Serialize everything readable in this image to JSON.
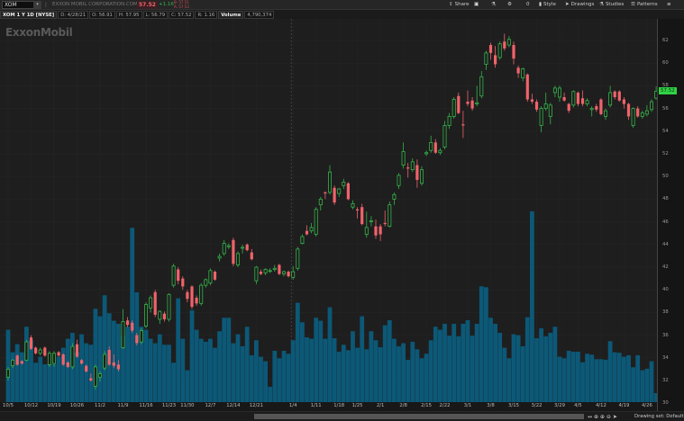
{
  "topbar": {
    "symbol": "XOM",
    "symbol_dropdown_icon": "chevron-down-icon",
    "company_name": "EXXON MOBIL CORPORATION.COM",
    "last_price": "57.52",
    "change": "+1.16",
    "bid": "B: 57.51",
    "ask": "A: 57.53",
    "toolbar": [
      {
        "icon": "share-icon",
        "glyph": "⇪",
        "label": "Share"
      },
      {
        "icon": "screenshot-icon",
        "glyph": "▣",
        "label": ""
      },
      {
        "icon": "flask-icon",
        "glyph": "⚗",
        "label": ""
      },
      {
        "icon": "gear-icon",
        "glyph": "⚙",
        "label": ""
      },
      {
        "icon": "counter-icon",
        "glyph": "",
        "label": "0"
      },
      {
        "icon": "style-icon",
        "glyph": "▮",
        "label": "Style"
      },
      {
        "icon": "cursor-icon",
        "glyph": "➤",
        "label": "Drawings"
      },
      {
        "icon": "studies-icon",
        "glyph": "⚗",
        "label": "Studies"
      },
      {
        "icon": "patterns-icon",
        "glyph": "☰",
        "label": "Patterns"
      },
      {
        "icon": "menu-icon",
        "glyph": "≡",
        "label": ""
      }
    ]
  },
  "info": {
    "title": "XOM 1 Y 1D [NYSE]",
    "date": "D: 4/28/21",
    "open": "O: 56.91",
    "high": "H: 57.95",
    "low": "L: 56.79",
    "close": "C: 57.52",
    "range": "R: 1.16",
    "volume_label": "Volume",
    "volume": "4,790,374"
  },
  "logo": "ExxonMobil",
  "footer": {
    "drawing_set": "Drawing set: Default"
  },
  "colors": {
    "up": "#35b34a",
    "down": "#f0636b",
    "volume": "#0c5877",
    "last_price_bg": "#2fd244"
  },
  "chart_data": {
    "type": "candlestick",
    "price_axis": {
      "min": 30,
      "max": 62,
      "ticks": [
        30,
        32,
        34,
        36,
        38,
        40,
        42,
        44,
        46,
        48,
        50,
        52,
        54,
        56,
        58,
        60,
        62
      ]
    },
    "last_price_label": "57.52",
    "x_ticks": [
      {
        "index": 0,
        "label": "10/5"
      },
      {
        "index": 5,
        "label": "10/12"
      },
      {
        "index": 10,
        "label": "10/19"
      },
      {
        "index": 15,
        "label": "10/26"
      },
      {
        "index": 20,
        "label": "11/2"
      },
      {
        "index": 25,
        "label": "11/9"
      },
      {
        "index": 30,
        "label": "11/16"
      },
      {
        "index": 35,
        "label": "11/23"
      },
      {
        "index": 39,
        "label": "11/30"
      },
      {
        "index": 44,
        "label": "12/7"
      },
      {
        "index": 49,
        "label": "12/14"
      },
      {
        "index": 54,
        "label": "12/21"
      },
      {
        "index": 62,
        "label": "1/4"
      },
      {
        "index": 67,
        "label": "1/11"
      },
      {
        "index": 72,
        "label": "1/18"
      },
      {
        "index": 76,
        "label": "1/25"
      },
      {
        "index": 81,
        "label": "2/1"
      },
      {
        "index": 86,
        "label": "2/8"
      },
      {
        "index": 91,
        "label": "2/15"
      },
      {
        "index": 95,
        "label": "2/22"
      },
      {
        "index": 100,
        "label": "3/1"
      },
      {
        "index": 105,
        "label": "3/8"
      },
      {
        "index": 110,
        "label": "3/15"
      },
      {
        "index": 115,
        "label": "3/22"
      },
      {
        "index": 120,
        "label": "3/29"
      },
      {
        "index": 124,
        "label": "4/5"
      },
      {
        "index": 129,
        "label": "4/12"
      },
      {
        "index": 134,
        "label": "4/19"
      },
      {
        "index": 139,
        "label": "4/26"
      }
    ],
    "year_separator_index": 62,
    "ohlc": [
      [
        32.3,
        33.2,
        32.0,
        33.0
      ],
      [
        33.3,
        33.9,
        33.1,
        33.8
      ],
      [
        34.2,
        34.3,
        33.3,
        33.4
      ],
      [
        33.7,
        33.8,
        33.4,
        33.5
      ],
      [
        33.8,
        35.6,
        33.7,
        35.4
      ],
      [
        35.8,
        36.0,
        34.7,
        34.8
      ],
      [
        34.9,
        35.0,
        34.3,
        34.4
      ],
      [
        34.4,
        34.9,
        34.2,
        34.7
      ],
      [
        34.9,
        35.0,
        34.1,
        34.2
      ],
      [
        33.4,
        34.6,
        33.2,
        34.4
      ],
      [
        33.5,
        34.6,
        33.2,
        34.4
      ],
      [
        34.5,
        34.6,
        34.1,
        34.2
      ],
      [
        34.3,
        34.4,
        33.3,
        33.4
      ],
      [
        33.6,
        33.7,
        33.1,
        33.2
      ],
      [
        33.2,
        35.3,
        33.0,
        35.0
      ],
      [
        35.2,
        35.6,
        34.0,
        34.1
      ],
      [
        33.8,
        33.9,
        33.4,
        33.5
      ],
      [
        33.3,
        33.4,
        32.7,
        32.8
      ],
      [
        32.2,
        32.6,
        31.9,
        32.0
      ],
      [
        31.5,
        33.4,
        31.2,
        33.2
      ],
      [
        32.3,
        32.8,
        31.9,
        32.6
      ],
      [
        33.1,
        34.6,
        32.9,
        34.3
      ],
      [
        34.7,
        35.0,
        33.3,
        33.4
      ],
      [
        33.6,
        34.3,
        33.1,
        33.3
      ],
      [
        33.4,
        33.8,
        32.8,
        33.0
      ],
      [
        34.9,
        38.3,
        34.8,
        37.2
      ],
      [
        37.3,
        37.6,
        36.7,
        36.9
      ],
      [
        37.1,
        37.3,
        36.2,
        36.4
      ],
      [
        36.0,
        36.2,
        35.1,
        35.3
      ],
      [
        35.4,
        36.6,
        35.2,
        36.4
      ],
      [
        36.8,
        38.9,
        36.6,
        38.7
      ],
      [
        38.4,
        39.5,
        38.0,
        39.3
      ],
      [
        39.8,
        40.0,
        37.6,
        37.8
      ],
      [
        37.4,
        38.2,
        37.0,
        38.1
      ],
      [
        37.9,
        38.1,
        37.2,
        37.4
      ],
      [
        37.4,
        39.7,
        37.2,
        39.6
      ],
      [
        40.4,
        42.3,
        40.2,
        42.1
      ],
      [
        41.8,
        42.0,
        40.5,
        40.8
      ],
      [
        41.0,
        41.2,
        40.0,
        40.3
      ],
      [
        39.8,
        40.0,
        38.9,
        39.2
      ],
      [
        40.3,
        40.4,
        38.3,
        38.5
      ],
      [
        39.3,
        39.5,
        38.6,
        38.8
      ],
      [
        38.8,
        40.6,
        38.6,
        40.4
      ],
      [
        40.4,
        41.0,
        40.2,
        40.9
      ],
      [
        40.6,
        41.9,
        40.4,
        41.7
      ],
      [
        41.6,
        41.7,
        40.8,
        40.9
      ],
      [
        42.8,
        43.2,
        42.5,
        42.95
      ],
      [
        43.2,
        44.4,
        43.0,
        44.1
      ],
      [
        43.8,
        44.1,
        43.6,
        43.9
      ],
      [
        44.4,
        44.6,
        42.1,
        42.3
      ],
      [
        42.2,
        43.4,
        42.0,
        43.2
      ],
      [
        43.7,
        44.0,
        43.2,
        43.75
      ],
      [
        44.0,
        44.1,
        43.4,
        43.5
      ],
      [
        43.3,
        43.6,
        42.6,
        42.7
      ],
      [
        40.8,
        42.1,
        40.5,
        42.0
      ],
      [
        41.6,
        41.8,
        41.3,
        41.4
      ],
      [
        41.5,
        41.9,
        41.3,
        41.8
      ],
      [
        41.7,
        41.9,
        41.5,
        41.7
      ],
      [
        41.8,
        42.2,
        41.6,
        41.9
      ],
      [
        42.2,
        42.3,
        41.3,
        41.4
      ],
      [
        41.4,
        41.7,
        41.2,
        41.6
      ],
      [
        41.6,
        41.7,
        41.1,
        41.2
      ],
      [
        41.1,
        42.1,
        40.9,
        41.6
      ],
      [
        41.9,
        43.8,
        41.7,
        43.6
      ],
      [
        44.1,
        44.9,
        44.0,
        44.7
      ],
      [
        45.2,
        45.7,
        44.8,
        44.9
      ],
      [
        45.2,
        45.9,
        45.0,
        45.5
      ],
      [
        44.9,
        47.3,
        44.7,
        47.1
      ],
      [
        47.5,
        48.2,
        47.0,
        48.0
      ],
      [
        48.6,
        48.7,
        48.0,
        48.5
      ],
      [
        48.6,
        51.0,
        48.4,
        50.4
      ],
      [
        49.0,
        49.2,
        47.5,
        47.7
      ],
      [
        48.5,
        49.0,
        48.2,
        48.9
      ],
      [
        49.2,
        49.8,
        48.9,
        49.5
      ],
      [
        49.4,
        49.5,
        47.9,
        48.0
      ],
      [
        47.3,
        47.9,
        47.1,
        47.6
      ],
      [
        47.1,
        47.3,
        46.3,
        47.0
      ],
      [
        47.3,
        47.6,
        45.7,
        45.8
      ],
      [
        44.9,
        46.9,
        44.6,
        45.5
      ],
      [
        46.0,
        46.5,
        45.6,
        46.1
      ],
      [
        45.6,
        46.2,
        44.5,
        44.8
      ],
      [
        45.6,
        45.8,
        44.3,
        44.9
      ],
      [
        45.9,
        47.0,
        45.6,
        45.8
      ],
      [
        45.6,
        47.8,
        45.5,
        47.5
      ],
      [
        48.0,
        48.6,
        47.5,
        48.4
      ],
      [
        49.2,
        50.3,
        48.9,
        50.1
      ],
      [
        51.0,
        53.0,
        50.7,
        52.2
      ],
      [
        50.8,
        51.2,
        49.9,
        50.7
      ],
      [
        50.6,
        51.6,
        50.4,
        51.3
      ],
      [
        51.0,
        51.5,
        49.0,
        49.7
      ],
      [
        49.4,
        50.9,
        49.2,
        50.6
      ],
      [
        52.0,
        52.3,
        51.8,
        52.1
      ],
      [
        52.3,
        53.6,
        52.1,
        53.0
      ],
      [
        53.0,
        53.3,
        52.0,
        52.1
      ],
      [
        52.1,
        52.5,
        51.9,
        52.3
      ],
      [
        52.6,
        54.9,
        52.4,
        54.5
      ],
      [
        54.5,
        55.6,
        54.2,
        55.3
      ],
      [
        55.3,
        57.0,
        55.1,
        56.8
      ],
      [
        57.1,
        57.4,
        55.5,
        55.6
      ],
      [
        54.6,
        55.8,
        53.4,
        54.5
      ],
      [
        56.6,
        57.6,
        56.2,
        56.4
      ],
      [
        56.7,
        57.0,
        55.8,
        56.0
      ],
      [
        56.4,
        58.0,
        56.2,
        56.5
      ],
      [
        57.1,
        59.3,
        56.9,
        58.8
      ],
      [
        59.9,
        61.1,
        59.4,
        60.9
      ],
      [
        61.6,
        61.8,
        60.3,
        60.9
      ],
      [
        60.7,
        61.5,
        59.6,
        59.9
      ],
      [
        60.5,
        61.9,
        60.3,
        61.7
      ],
      [
        61.9,
        62.6,
        61.1,
        61.3
      ],
      [
        61.6,
        62.4,
        61.4,
        62.1
      ],
      [
        61.6,
        61.9,
        59.9,
        60.4
      ],
      [
        59.6,
        59.8,
        58.7,
        59.1
      ],
      [
        58.7,
        59.6,
        58.4,
        59.5
      ],
      [
        59.0,
        59.1,
        56.6,
        56.8
      ],
      [
        56.8,
        57.3,
        56.4,
        56.6
      ],
      [
        56.6,
        56.8,
        55.7,
        55.9
      ],
      [
        54.5,
        56.2,
        53.9,
        56.0
      ],
      [
        56.0,
        57.4,
        55.8,
        56.4
      ],
      [
        55.3,
        56.5,
        54.6,
        56.3
      ],
      [
        57.4,
        58.0,
        57.0,
        57.8
      ],
      [
        57.0,
        58.0,
        56.6,
        57.8
      ],
      [
        57.0,
        57.4,
        56.6,
        56.7
      ],
      [
        56.4,
        56.5,
        55.6,
        55.8
      ],
      [
        56.3,
        57.6,
        56.1,
        57.5
      ],
      [
        57.4,
        57.5,
        56.2,
        56.4
      ],
      [
        56.9,
        57.6,
        56.2,
        56.4
      ],
      [
        56.4,
        56.9,
        56.2,
        56.7
      ],
      [
        55.9,
        56.2,
        55.3,
        56.0
      ],
      [
        56.2,
        56.4,
        55.7,
        55.9
      ],
      [
        56.8,
        56.9,
        55.4,
        55.5
      ],
      [
        55.3,
        56.0,
        55.0,
        55.8
      ],
      [
        56.3,
        58.0,
        56.1,
        57.4
      ],
      [
        57.5,
        57.6,
        56.8,
        57.0
      ],
      [
        57.5,
        57.6,
        56.6,
        56.7
      ],
      [
        56.8,
        57.0,
        56.0,
        56.4
      ],
      [
        56.4,
        56.5,
        55.0,
        55.3
      ],
      [
        54.5,
        56.1,
        54.3,
        56.0
      ],
      [
        56.0,
        56.2,
        55.2,
        55.3
      ],
      [
        55.3,
        55.8,
        55.1,
        55.6
      ],
      [
        55.5,
        56.3,
        55.3,
        55.8
      ],
      [
        55.9,
        56.8,
        55.7,
        56.6
      ],
      [
        56.91,
        57.95,
        56.79,
        57.52
      ]
    ],
    "volume_millions": [
      38.6,
      26.6,
      30.9,
      26.6,
      40.2,
      33.0,
      21.0,
      24.2,
      20.2,
      20.2,
      20.2,
      24.2,
      29.0,
      33.8,
      37.0,
      26.6,
      36.2,
      31.4,
      30.6,
      49.8,
      45.8,
      57.0,
      47.4,
      43.4,
      41.8,
      35.4,
      40.2,
      93.0,
      58.6,
      40.2,
      38.6,
      33.8,
      31.4,
      36.2,
      30.6,
      30.6,
      21.0,
      55.4,
      33.8,
      17.0,
      49.0,
      38.6,
      33.8,
      32.2,
      33.8,
      29.0,
      37.8,
      45.0,
      45.0,
      31.4,
      36.2,
      29.8,
      40.2,
      25.0,
      33.0,
      24.2,
      21.8,
      8.2,
      27.4,
      23.4,
      27.4,
      25.8,
      33.0,
      53.0,
      42.6,
      34.6,
      33.8,
      45.0,
      43.4,
      33.8,
      50.6,
      34.1,
      26.9,
      30.6,
      27.7,
      37.8,
      29.0,
      45.8,
      28.2,
      37.8,
      33.0,
      29.3,
      41.0,
      43.7,
      33.8,
      29.8,
      31.4,
      22.6,
      32.2,
      28.2,
      23.4,
      25.8,
      33.0,
      40.2,
      38.6,
      41.8,
      35.4,
      41.8,
      35.1,
      41.8,
      43.7,
      35.4,
      41.8,
      61.8,
      61.3,
      45.0,
      41.8,
      37.0,
      29.0,
      23.4,
      36.2,
      35.7,
      29.8,
      45.3,
      101.8,
      34.1,
      39.4,
      35.1,
      37.0,
      40.2,
      24.2,
      23.4,
      27.4,
      26.9,
      26.9,
      21.3,
      25.8,
      25.3,
      22.9,
      22.9,
      22.6,
      32.5,
      26.6,
      26.3,
      24.2,
      25.0,
      18.6,
      25.0,
      17.0,
      17.8,
      21.8,
      4.79
    ]
  }
}
